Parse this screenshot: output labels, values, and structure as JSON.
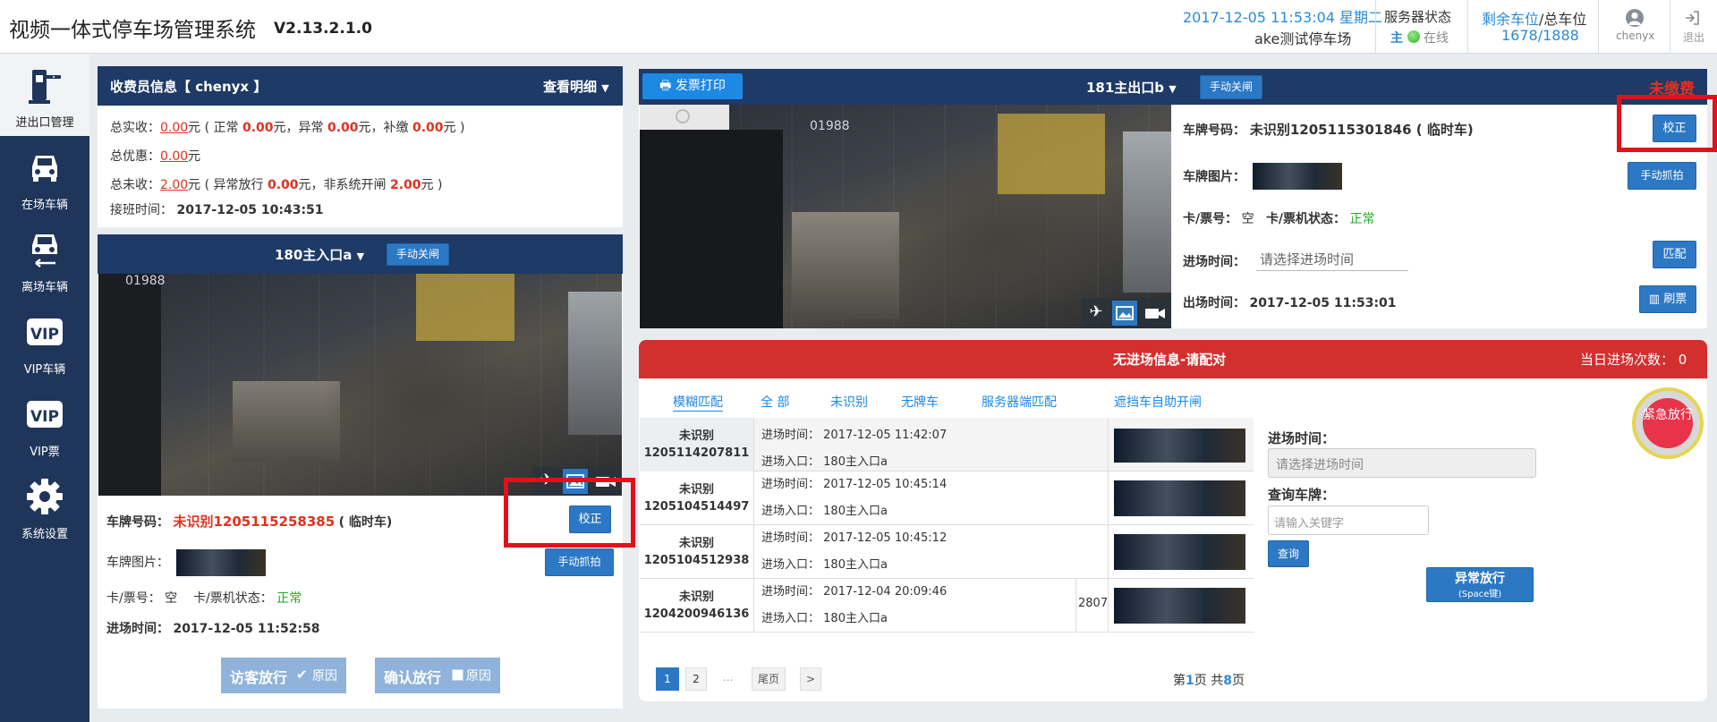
{
  "header": {
    "title": "视频一体式停车场管理系统",
    "version": "V2.13.2.1.0",
    "datetime": "2017-12-05 11:53:04 星期二",
    "lot_name": "ake测试停车场",
    "server_status_label": "服务器状态",
    "server_main": "主",
    "server_online": "在线",
    "spaces_label_remaining": "剩余车位",
    "spaces_label_sep": "/总车位",
    "spaces_value": "1678/1888",
    "user_name": "chenyx",
    "logout_label": "退出"
  },
  "sidebar": {
    "items": [
      {
        "label": "进出口管理",
        "icon": "barrier-gate-icon",
        "active": true
      },
      {
        "label": "在场车辆",
        "icon": "car-icon"
      },
      {
        "label": "离场车辆",
        "icon": "car-exit-icon"
      },
      {
        "label": "VIP车辆",
        "icon": "vip-icon"
      },
      {
        "label": "VIP票",
        "icon": "vip-ticket-icon"
      },
      {
        "label": "系统设置",
        "icon": "gear-icon"
      }
    ]
  },
  "cashier": {
    "title": "收费员信息【 chenyx 】",
    "details_link": "查看明细",
    "total_paid_label": "总实收：",
    "total_paid": "0.00",
    "yuan": "元",
    "normal_label": "( 正常",
    "normal": "0.00",
    "abnormal_label": "元，异常",
    "abnormal": "0.00",
    "supplement_label": "元，补缴",
    "supplement": "0.00",
    "close_paren": "元 )",
    "total_discount_label": "总优惠：",
    "total_discount": "0.00",
    "total_unpaid_label": "总未收：",
    "total_unpaid": "2.00",
    "abnormal_release_label": "( 异常放行",
    "abnormal_release": "0.00",
    "non_system_label": "元，非系统开闸",
    "non_system": "2.00",
    "shift_label": "接班时间：",
    "shift_time": "2017-12-05 10:43:51"
  },
  "entrance": {
    "gate_name": "180主入口a",
    "manual_close": "手动关闸",
    "plate_label": "车牌号码：",
    "plate_value": "未识别1205115258385",
    "plate_type": "( 临时车)",
    "correct_btn": "校正",
    "plate_img_label": "车牌图片：",
    "manual_capture": "手动抓拍",
    "card_label": "卡/票号：",
    "card_value": "空",
    "card_status_label": "卡/票机状态：",
    "card_status": "正常",
    "entry_time_label": "进场时间：",
    "entry_time": "2017-12-05 11:52:58",
    "visitor_release": "访客放行",
    "confirm_release": "确认放行",
    "reason": "原因",
    "cam_overlay": "01988"
  },
  "exit": {
    "invoice_btn": "发票打印",
    "gate_name": "181主出口b",
    "manual_close": "手动关闸",
    "unpaid_status": "未缴费",
    "plate_label": "车牌号码：",
    "plate_value": "未识别1205115301846 ( 临时车)",
    "correct_btn": "校正",
    "plate_img_label": "车牌图片：",
    "manual_capture": "手动抓拍",
    "card_label": "卡/票号：",
    "card_value": "空",
    "card_status_label": "卡/票机状态：",
    "card_status": "正常",
    "entry_time_label": "进场时间：",
    "entry_time_placeholder": "请选择进场时间",
    "match_btn": "匹配",
    "exit_time_label": "出场时间：",
    "exit_time": "2017-12-05 11:53:01",
    "refresh_btn": "刷票",
    "cam_overlay": "01988"
  },
  "match": {
    "title": "无进场信息-请配对",
    "today_count_label": "当日进场次数：",
    "today_count": "0",
    "emergency": "紧急放行",
    "tabs": [
      "模糊匹配",
      "全  部",
      "未识别",
      "无牌车",
      "服务器端匹配",
      "遮挡车",
      "自助开闸"
    ],
    "rows": [
      {
        "plate1": "未识别",
        "plate2": "1205114207811",
        "time_label": "进场时间：",
        "time": "2017-12-05 11:42:07",
        "entry_label": "进场入口：",
        "entry": "180主入口a",
        "extra": ""
      },
      {
        "plate1": "未识别",
        "plate2": "1205104514497",
        "time_label": "进场时间：",
        "time": "2017-12-05 10:45:14",
        "entry_label": "进场入口：",
        "entry": "180主入口a",
        "extra": ""
      },
      {
        "plate1": "未识别",
        "plate2": "1205104512938",
        "time_label": "进场时间：",
        "time": "2017-12-05 10:45:12",
        "entry_label": "进场入口：",
        "entry": "180主入口a",
        "extra": ""
      },
      {
        "plate1": "未识别",
        "plate2": "1204200946136",
        "time_label": "进场时间：",
        "time": "2017-12-04 20:09:46",
        "entry_label": "进场入口：",
        "entry": "180主入口a",
        "extra": "2807"
      }
    ],
    "entry_time_label": "进场时间：",
    "entry_time_placeholder": "请选择进场时间",
    "query_plate_label": "查询车牌：",
    "query_plate_placeholder": "请输入关键字",
    "query_btn": "查询",
    "abnormal_release": "异常放行",
    "abnormal_release_hint": "(Space键)",
    "pagination": {
      "pages": [
        "1",
        "2",
        "...",
        "尾页",
        ">"
      ],
      "summary_prefix": "第",
      "current": "1",
      "summary_mid": "页 共",
      "total": "8",
      "summary_suffix": "页"
    }
  }
}
